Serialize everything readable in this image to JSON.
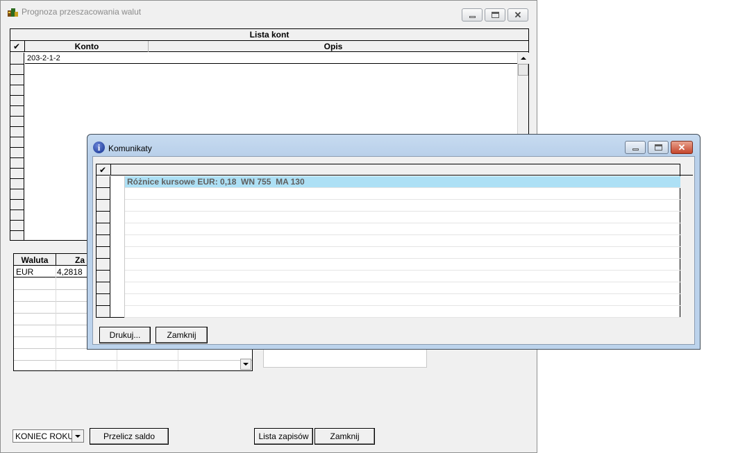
{
  "main_window": {
    "title": "Prognoza przeszacowania walut",
    "accounts_grid": {
      "caption": "Lista kont",
      "check_glyph": "✔",
      "columns": [
        "Konto",
        "Opis"
      ],
      "rows": [
        {
          "konto": "203-2-1-2",
          "opis": ""
        }
      ]
    },
    "currency_grid": {
      "columns": [
        "Waluta",
        "Za"
      ],
      "rows": [
        {
          "waluta": "EUR",
          "value": "4,2818"
        }
      ]
    },
    "period_select": {
      "value": "KONIEC ROKU"
    },
    "buttons": {
      "recalc": "Przelicz saldo",
      "list_entries": "Lista zapisów",
      "close": "Zamknij"
    }
  },
  "dialog": {
    "title": "Komunikaty",
    "check_glyph": "✔",
    "messages": [
      "Różnice kursowe EUR: 0,18  WN 755  MA 130"
    ],
    "buttons": {
      "print": "Drukuj...",
      "close": "Zamknij"
    },
    "colors": {
      "selected_row": "#ade0f5"
    }
  }
}
